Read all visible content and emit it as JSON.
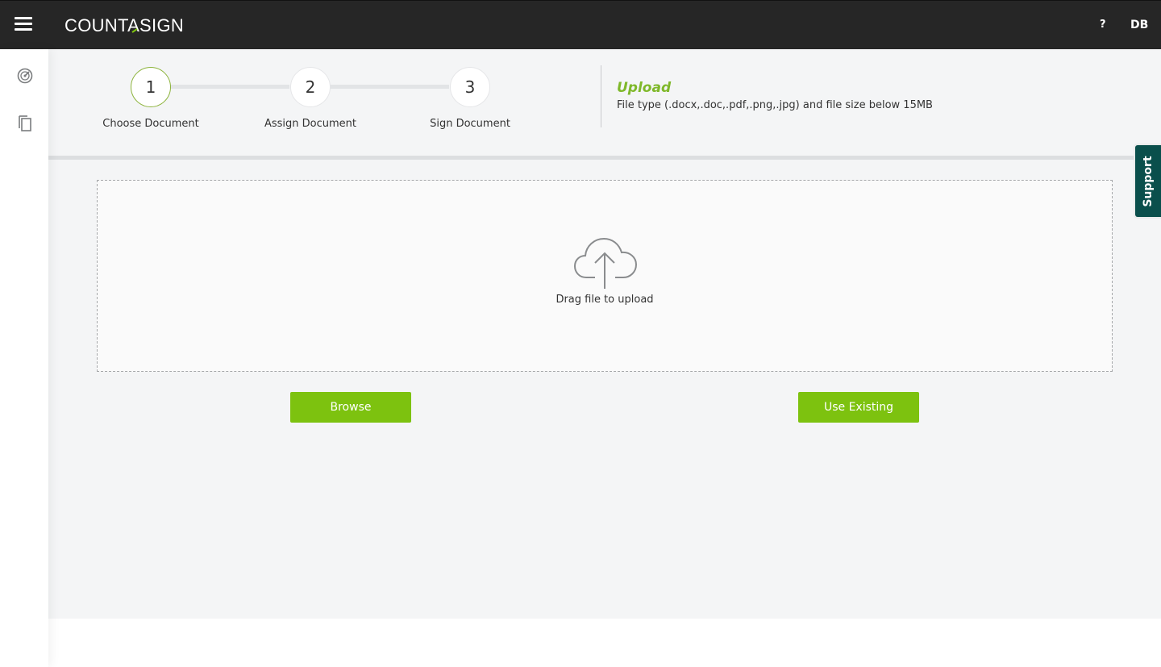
{
  "topbar": {
    "logo_text": "COUNTASIGN",
    "help_label": "?",
    "user_initials": "DB"
  },
  "sidebar": {
    "items": [
      {
        "icon": "dashboard-gauge-icon"
      },
      {
        "icon": "documents-copy-icon"
      }
    ]
  },
  "steps": [
    {
      "number": "1",
      "label": "Choose Document",
      "active": true
    },
    {
      "number": "2",
      "label": "Assign Document",
      "active": false
    },
    {
      "number": "3",
      "label": "Sign Document",
      "active": false
    }
  ],
  "upload_info": {
    "title": "Upload",
    "description": "File type (.docx,.doc,.pdf,.png,.jpg) and file size below 15MB"
  },
  "dropzone": {
    "icon": "cloud-upload-icon",
    "text": "Drag file to upload"
  },
  "buttons": {
    "browse": "Browse",
    "use_existing": "Use Existing"
  },
  "support_tab": {
    "label": "Support"
  },
  "colors": {
    "accent_green": "#7dc20f",
    "upload_title_green": "#7fb82a",
    "topbar": "#262626",
    "support_teal": "#0a4f4c"
  }
}
